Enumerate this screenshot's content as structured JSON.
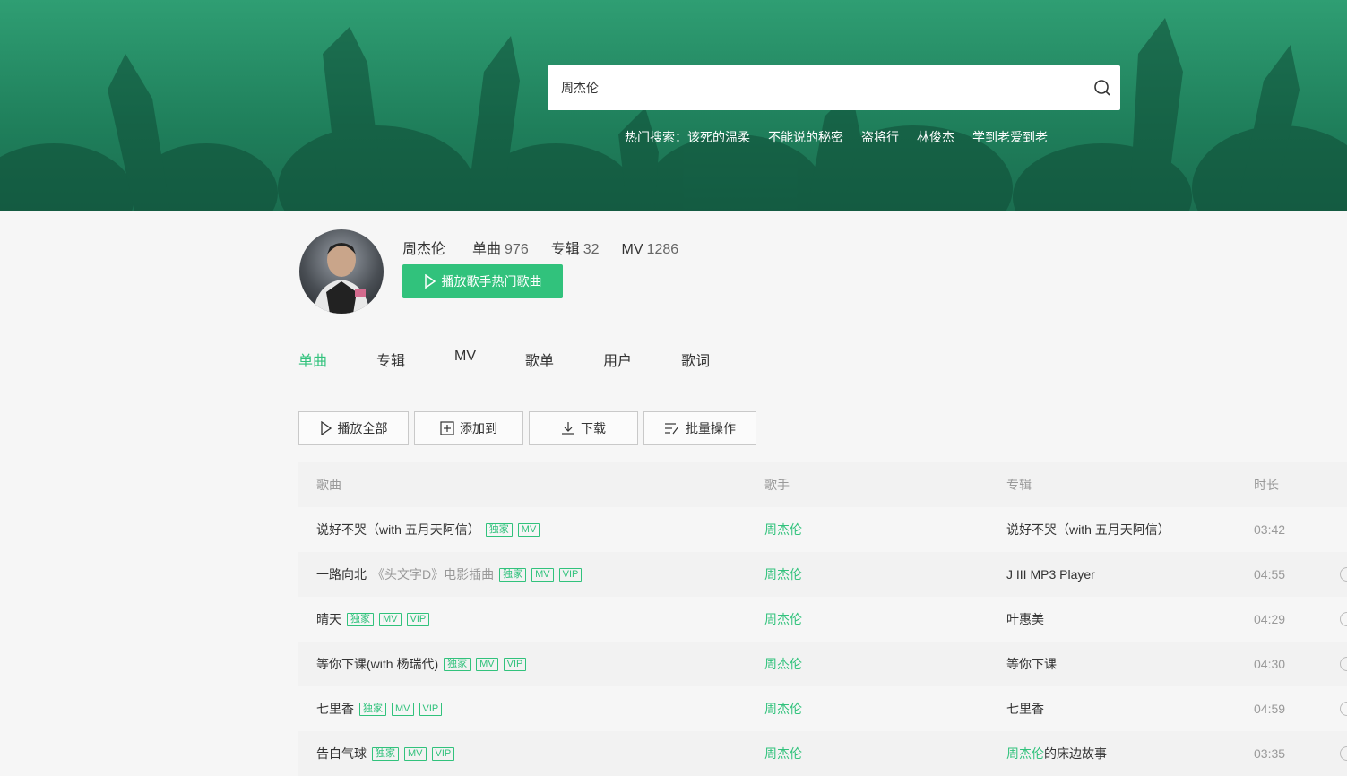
{
  "search": {
    "value": "周杰伦",
    "hot_label": "热门搜索：",
    "hot_items": [
      "该死的温柔",
      "不能说的秘密",
      "盗将行",
      "林俊杰",
      "学到老爱到老"
    ]
  },
  "singer": {
    "name": "周杰伦",
    "stats": [
      {
        "label": "单曲",
        "value": "976"
      },
      {
        "label": "专辑",
        "value": "32"
      },
      {
        "label": "MV",
        "value": "1286"
      }
    ],
    "play_hot_label": "播放歌手热门歌曲"
  },
  "tabs": [
    {
      "label": "单曲",
      "active": true
    },
    {
      "label": "专辑",
      "active": false
    },
    {
      "label": "MV",
      "active": false
    },
    {
      "label": "歌单",
      "active": false
    },
    {
      "label": "用户",
      "active": false
    },
    {
      "label": "歌词",
      "active": false
    }
  ],
  "toolbar": {
    "play_all": "播放全部",
    "add_to": "添加到",
    "download": "下载",
    "batch": "批量操作"
  },
  "table": {
    "headers": {
      "song": "歌曲",
      "singer": "歌手",
      "album": "专辑",
      "duration": "时长"
    },
    "rows": [
      {
        "title": "说好不哭（with 五月天阿信）",
        "sub": "",
        "tags": [
          "独家",
          "MV"
        ],
        "singer": "周杰伦",
        "album": "说好不哭（with 五月天阿信）",
        "album_hl": "",
        "duration": "03:42"
      },
      {
        "title": "一路向北",
        "sub": "《头文字D》电影插曲",
        "tags": [
          "独家",
          "MV",
          "VIP"
        ],
        "singer": "周杰伦",
        "album": "J III MP3 Player",
        "album_hl": "",
        "duration": "04:55"
      },
      {
        "title": "晴天",
        "sub": "",
        "tags": [
          "独家",
          "MV",
          "VIP"
        ],
        "singer": "周杰伦",
        "album": "叶惠美",
        "album_hl": "",
        "duration": "04:29"
      },
      {
        "title": "等你下课(with 杨瑞代)",
        "sub": "",
        "tags": [
          "独家",
          "MV",
          "VIP"
        ],
        "singer": "周杰伦",
        "album": "等你下课",
        "album_hl": "",
        "duration": "04:30"
      },
      {
        "title": "七里香",
        "sub": "",
        "tags": [
          "独家",
          "MV",
          "VIP"
        ],
        "singer": "周杰伦",
        "album": "七里香",
        "album_hl": "",
        "duration": "04:59"
      },
      {
        "title": "告白气球",
        "sub": "",
        "tags": [
          "独家",
          "MV",
          "VIP"
        ],
        "singer": "周杰伦",
        "album": "的床边故事",
        "album_hl": "周杰伦",
        "duration": "03:35"
      }
    ]
  },
  "colors": {
    "accent": "#31c27c",
    "banner": "#2a8f68"
  }
}
